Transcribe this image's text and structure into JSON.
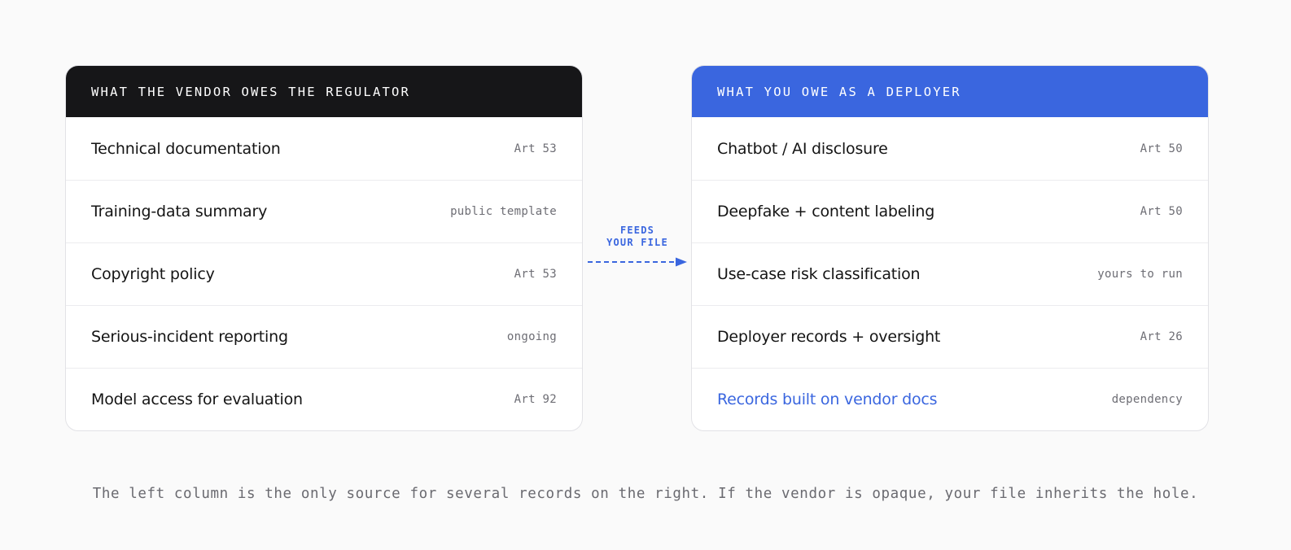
{
  "vendor_panel": {
    "title": "WHAT THE VENDOR OWES THE REGULATOR",
    "header_color": "#161618",
    "rows": [
      {
        "label": "Technical documentation",
        "tag": "Art 53"
      },
      {
        "label": "Training-data summary",
        "tag": "public template"
      },
      {
        "label": "Copyright policy",
        "tag": "Art 53"
      },
      {
        "label": "Serious-incident reporting",
        "tag": "ongoing"
      },
      {
        "label": "Model access for evaluation",
        "tag": "Art 92"
      }
    ]
  },
  "connector": {
    "label_line1": "FEEDS",
    "label_line2": "YOUR FILE",
    "icon": "dashed-arrow-right-icon",
    "color": "#3a66df"
  },
  "deployer_panel": {
    "title": "WHAT YOU OWE AS A DEPLOYER",
    "header_color": "#3a66df",
    "rows": [
      {
        "label": "Chatbot / AI disclosure",
        "tag": "Art 50"
      },
      {
        "label": "Deepfake + content labeling",
        "tag": "Art 50"
      },
      {
        "label": "Use-case risk classification",
        "tag": "yours to run"
      },
      {
        "label": "Deployer records + oversight",
        "tag": "Art 26"
      },
      {
        "label": "Records built on vendor docs",
        "tag": "dependency",
        "highlight": true
      }
    ]
  },
  "caption": "The left column is the only source for several records on the right. If the vendor is opaque, your file inherits the hole."
}
